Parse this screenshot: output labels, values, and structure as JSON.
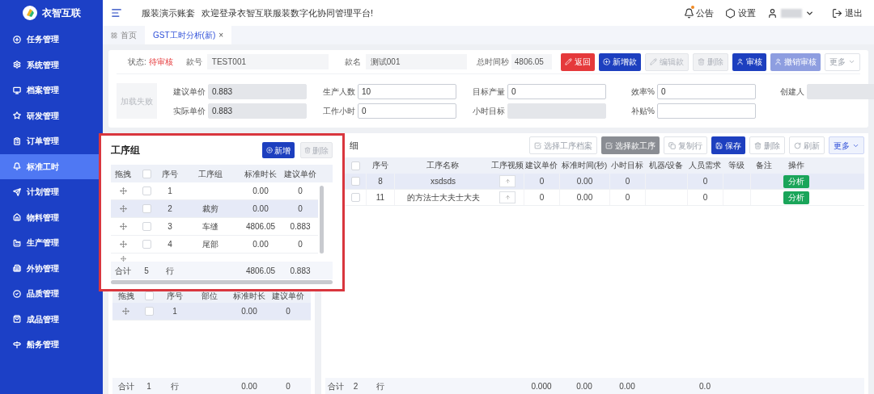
{
  "sidebar": {
    "logo": "衣智互联",
    "items": [
      {
        "label": "任务管理",
        "selected": false
      },
      {
        "label": "系统管理",
        "selected": false
      },
      {
        "label": "档案管理",
        "selected": false
      },
      {
        "label": "研发管理",
        "selected": false
      },
      {
        "label": "订单管理",
        "selected": false
      },
      {
        "label": "标准工时",
        "selected": true
      },
      {
        "label": "计划管理",
        "selected": false
      },
      {
        "label": "物料管理",
        "selected": false
      },
      {
        "label": "生产管理",
        "selected": false
      },
      {
        "label": "外协管理",
        "selected": false
      },
      {
        "label": "品质管理",
        "selected": false
      },
      {
        "label": "成品管理",
        "selected": false
      },
      {
        "label": "船务管理",
        "selected": false
      }
    ]
  },
  "topbar": {
    "account": "服装演示账套",
    "welcome": "欢迎登录衣智互联服装数字化协同管理平台!",
    "notice": {
      "label": "公告",
      "unread": true
    },
    "settings": "设置",
    "logout": "退出"
  },
  "tabs": [
    {
      "label": "首页",
      "selected": false
    },
    {
      "label": "GST工时分析(新)",
      "selected": true,
      "close": "×"
    }
  ],
  "header": {
    "status_label": "状态:",
    "status": "待审核",
    "style_no": {
      "label": "款号",
      "value": "TEST001"
    },
    "style_name": {
      "label": "款名",
      "value": "测试001"
    },
    "total_seconds": {
      "label": "总时间秒",
      "value": "4806.05"
    },
    "buttons": [
      {
        "label": "返回",
        "kind": "danger"
      },
      {
        "label": "新增款",
        "kind": "primary"
      },
      {
        "label": "编辑款",
        "kind": "disabled"
      },
      {
        "label": "删除",
        "kind": "disabled"
      },
      {
        "label": "审核",
        "kind": "primary"
      },
      {
        "label": "撤销审核",
        "kind": "light"
      },
      {
        "label": "更多",
        "kind": "outline"
      }
    ],
    "image_placeholder": "加载失败",
    "fields": [
      {
        "label": "建议单价",
        "value": "0.883",
        "readonly": true
      },
      {
        "label": "生产人数",
        "value": "10",
        "readonly": false
      },
      {
        "label": "目标产量",
        "value": "0",
        "readonly": false
      },
      {
        "label": "效率%",
        "value": "0",
        "readonly": false
      },
      {
        "label": "创建人",
        "readonly": true
      },
      {
        "label": "实际单价",
        "value": "0.883",
        "readonly": true
      },
      {
        "label": "工作小时",
        "value": "0",
        "readonly": false
      },
      {
        "label": "小时目标",
        "readonly": true
      },
      {
        "label": "补贴%",
        "readonly": false
      }
    ]
  },
  "group_popup": {
    "title": "工序组",
    "buttons": [
      {
        "label": "新增",
        "kind": "primary"
      },
      {
        "label": "删除",
        "kind": "disabled"
      }
    ],
    "columns": [
      {
        "kind": "drag",
        "label": "拖拽"
      },
      {
        "kind": "checkbox",
        "checked": false
      },
      {
        "kind": "text",
        "label": "序号"
      },
      {
        "kind": "text",
        "label": "工序组"
      },
      {
        "kind": "text",
        "label": "标准时长"
      },
      {
        "kind": "text",
        "label": "建议单价"
      }
    ],
    "rows": [
      {
        "cells": [
          "",
          "",
          "1",
          "",
          "0.00",
          "0"
        ],
        "checked": false,
        "selected": false
      },
      {
        "cells": [
          "",
          "",
          "2",
          "裁剪",
          "0.00",
          "0"
        ],
        "checked": false,
        "selected": true
      },
      {
        "cells": [
          "",
          "",
          "3",
          "车缝",
          "4806.05",
          "0.883"
        ],
        "checked": false,
        "selected": false
      },
      {
        "cells": [
          "",
          "",
          "4",
          "尾部",
          "0.00",
          "0"
        ],
        "checked": false,
        "selected": false
      }
    ],
    "footer": {
      "cells": [
        "合计",
        "5",
        "行",
        "",
        "4806.05",
        "0.883"
      ]
    }
  },
  "part_table": {
    "columns": [
      {
        "kind": "drag",
        "label": "拖拽"
      },
      {
        "kind": "checkbox",
        "checked": false
      },
      {
        "kind": "text",
        "label": "序号"
      },
      {
        "kind": "text",
        "label": "部位"
      },
      {
        "kind": "text",
        "label": "标准时长"
      },
      {
        "kind": "text",
        "label": "建议单价"
      }
    ],
    "rows": [
      {
        "cells": [
          "",
          "",
          "1",
          "",
          "0.00",
          "0"
        ],
        "checked": false,
        "selected": true
      }
    ],
    "footer": {
      "cells": [
        "合计",
        "1",
        "行",
        "",
        "0.00",
        "0"
      ]
    }
  },
  "detail": {
    "title": "细",
    "buttons": [
      {
        "label": "选择工序档案",
        "kind": "outline"
      },
      {
        "label": "选择款工序",
        "kind": "gray"
      },
      {
        "label": "复制行",
        "kind": "outline"
      },
      {
        "label": "保存",
        "kind": "primary"
      },
      {
        "label": "删除",
        "kind": "outline"
      },
      {
        "label": "刷新",
        "kind": "outline"
      },
      {
        "label": "更多",
        "kind": "more"
      }
    ],
    "columns": [
      {
        "kind": "blank"
      },
      {
        "kind": "checkbox",
        "checked": false
      },
      {
        "kind": "text",
        "label": "序号"
      },
      {
        "kind": "text",
        "label": "工序名称"
      },
      {
        "kind": "video",
        "label": "工序视频"
      },
      {
        "kind": "text",
        "label": "建议单价"
      },
      {
        "kind": "text",
        "label": "标准时间(秒)"
      },
      {
        "kind": "text",
        "label": "小时目标"
      },
      {
        "kind": "text",
        "label": "机器/设备"
      },
      {
        "kind": "text",
        "label": "人员需求"
      },
      {
        "kind": "text",
        "label": "等级"
      },
      {
        "kind": "text",
        "label": "备注"
      },
      {
        "kind": "action",
        "label": "操作"
      }
    ],
    "rows": [
      {
        "cells": [
          "",
          "",
          "8",
          "xsdsds",
          "",
          "0",
          "0.00",
          "0",
          "",
          "0",
          "",
          "",
          "分析"
        ],
        "checked": false,
        "selected": true
      },
      {
        "cells": [
          "",
          "",
          "11",
          "的方法士大夫士大夫",
          "",
          "0",
          "0.00",
          "0",
          "",
          "0",
          "",
          "",
          "分析"
        ],
        "checked": false,
        "selected": false
      }
    ],
    "footer": {
      "cells": [
        "合计",
        "2",
        "行",
        "",
        "",
        "0.000",
        "0.00",
        "0.00",
        "",
        "0.0",
        "",
        "",
        ""
      ]
    }
  }
}
